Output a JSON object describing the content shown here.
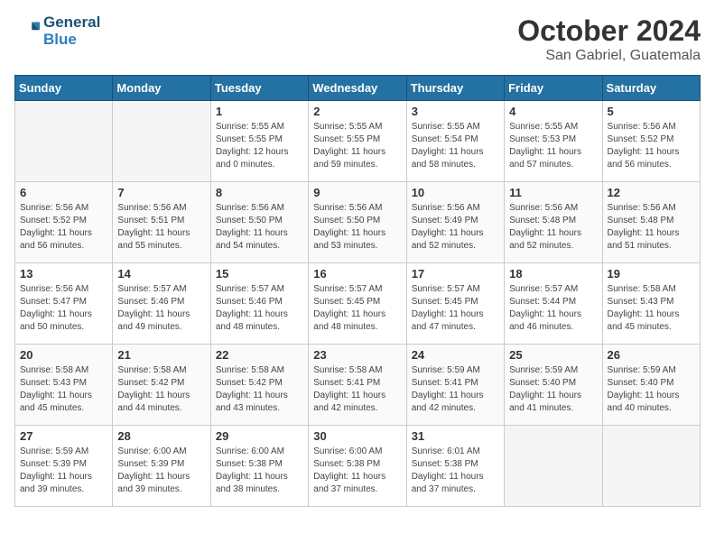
{
  "header": {
    "logo_line1": "General",
    "logo_line2": "Blue",
    "month": "October 2024",
    "location": "San Gabriel, Guatemala"
  },
  "weekdays": [
    "Sunday",
    "Monday",
    "Tuesday",
    "Wednesday",
    "Thursday",
    "Friday",
    "Saturday"
  ],
  "weeks": [
    [
      {
        "day": "",
        "info": ""
      },
      {
        "day": "",
        "info": ""
      },
      {
        "day": "1",
        "info": "Sunrise: 5:55 AM\nSunset: 5:55 PM\nDaylight: 12 hours\nand 0 minutes."
      },
      {
        "day": "2",
        "info": "Sunrise: 5:55 AM\nSunset: 5:55 PM\nDaylight: 11 hours\nand 59 minutes."
      },
      {
        "day": "3",
        "info": "Sunrise: 5:55 AM\nSunset: 5:54 PM\nDaylight: 11 hours\nand 58 minutes."
      },
      {
        "day": "4",
        "info": "Sunrise: 5:55 AM\nSunset: 5:53 PM\nDaylight: 11 hours\nand 57 minutes."
      },
      {
        "day": "5",
        "info": "Sunrise: 5:56 AM\nSunset: 5:52 PM\nDaylight: 11 hours\nand 56 minutes."
      }
    ],
    [
      {
        "day": "6",
        "info": "Sunrise: 5:56 AM\nSunset: 5:52 PM\nDaylight: 11 hours\nand 56 minutes."
      },
      {
        "day": "7",
        "info": "Sunrise: 5:56 AM\nSunset: 5:51 PM\nDaylight: 11 hours\nand 55 minutes."
      },
      {
        "day": "8",
        "info": "Sunrise: 5:56 AM\nSunset: 5:50 PM\nDaylight: 11 hours\nand 54 minutes."
      },
      {
        "day": "9",
        "info": "Sunrise: 5:56 AM\nSunset: 5:50 PM\nDaylight: 11 hours\nand 53 minutes."
      },
      {
        "day": "10",
        "info": "Sunrise: 5:56 AM\nSunset: 5:49 PM\nDaylight: 11 hours\nand 52 minutes."
      },
      {
        "day": "11",
        "info": "Sunrise: 5:56 AM\nSunset: 5:48 PM\nDaylight: 11 hours\nand 52 minutes."
      },
      {
        "day": "12",
        "info": "Sunrise: 5:56 AM\nSunset: 5:48 PM\nDaylight: 11 hours\nand 51 minutes."
      }
    ],
    [
      {
        "day": "13",
        "info": "Sunrise: 5:56 AM\nSunset: 5:47 PM\nDaylight: 11 hours\nand 50 minutes."
      },
      {
        "day": "14",
        "info": "Sunrise: 5:57 AM\nSunset: 5:46 PM\nDaylight: 11 hours\nand 49 minutes."
      },
      {
        "day": "15",
        "info": "Sunrise: 5:57 AM\nSunset: 5:46 PM\nDaylight: 11 hours\nand 48 minutes."
      },
      {
        "day": "16",
        "info": "Sunrise: 5:57 AM\nSunset: 5:45 PM\nDaylight: 11 hours\nand 48 minutes."
      },
      {
        "day": "17",
        "info": "Sunrise: 5:57 AM\nSunset: 5:45 PM\nDaylight: 11 hours\nand 47 minutes."
      },
      {
        "day": "18",
        "info": "Sunrise: 5:57 AM\nSunset: 5:44 PM\nDaylight: 11 hours\nand 46 minutes."
      },
      {
        "day": "19",
        "info": "Sunrise: 5:58 AM\nSunset: 5:43 PM\nDaylight: 11 hours\nand 45 minutes."
      }
    ],
    [
      {
        "day": "20",
        "info": "Sunrise: 5:58 AM\nSunset: 5:43 PM\nDaylight: 11 hours\nand 45 minutes."
      },
      {
        "day": "21",
        "info": "Sunrise: 5:58 AM\nSunset: 5:42 PM\nDaylight: 11 hours\nand 44 minutes."
      },
      {
        "day": "22",
        "info": "Sunrise: 5:58 AM\nSunset: 5:42 PM\nDaylight: 11 hours\nand 43 minutes."
      },
      {
        "day": "23",
        "info": "Sunrise: 5:58 AM\nSunset: 5:41 PM\nDaylight: 11 hours\nand 42 minutes."
      },
      {
        "day": "24",
        "info": "Sunrise: 5:59 AM\nSunset: 5:41 PM\nDaylight: 11 hours\nand 42 minutes."
      },
      {
        "day": "25",
        "info": "Sunrise: 5:59 AM\nSunset: 5:40 PM\nDaylight: 11 hours\nand 41 minutes."
      },
      {
        "day": "26",
        "info": "Sunrise: 5:59 AM\nSunset: 5:40 PM\nDaylight: 11 hours\nand 40 minutes."
      }
    ],
    [
      {
        "day": "27",
        "info": "Sunrise: 5:59 AM\nSunset: 5:39 PM\nDaylight: 11 hours\nand 39 minutes."
      },
      {
        "day": "28",
        "info": "Sunrise: 6:00 AM\nSunset: 5:39 PM\nDaylight: 11 hours\nand 39 minutes."
      },
      {
        "day": "29",
        "info": "Sunrise: 6:00 AM\nSunset: 5:38 PM\nDaylight: 11 hours\nand 38 minutes."
      },
      {
        "day": "30",
        "info": "Sunrise: 6:00 AM\nSunset: 5:38 PM\nDaylight: 11 hours\nand 37 minutes."
      },
      {
        "day": "31",
        "info": "Sunrise: 6:01 AM\nSunset: 5:38 PM\nDaylight: 11 hours\nand 37 minutes."
      },
      {
        "day": "",
        "info": ""
      },
      {
        "day": "",
        "info": ""
      }
    ]
  ]
}
